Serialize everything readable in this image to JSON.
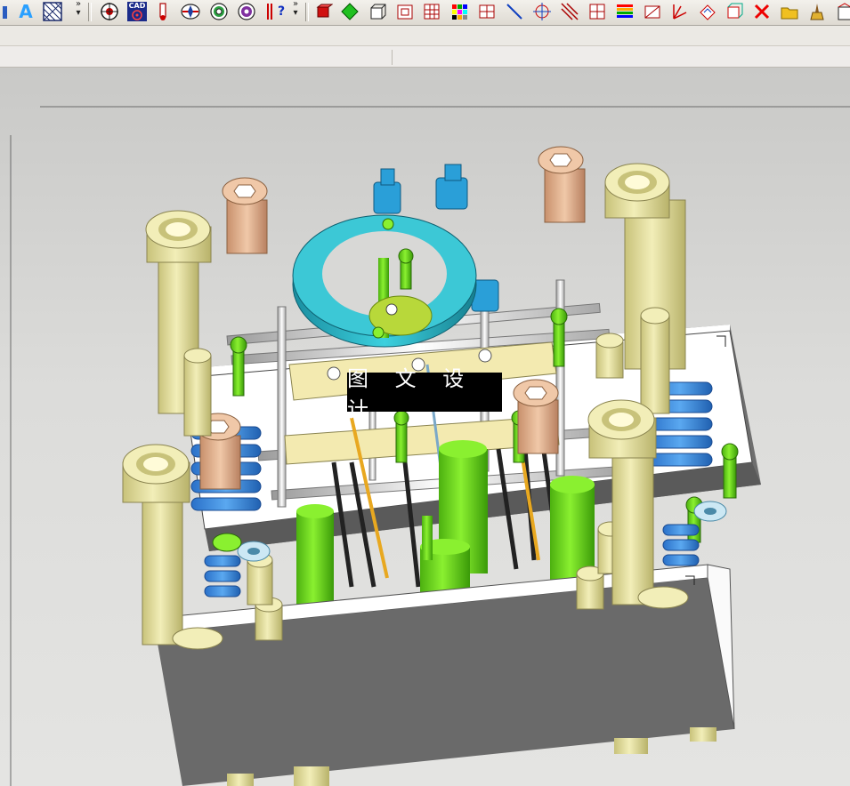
{
  "toolbar": {
    "cad_label": "CAD",
    "text_tool_glyph": "A",
    "query_tool_glyph": "?",
    "more_glyph": "»",
    "icons": [
      "red-block-icon",
      "green-diamond-icon",
      "box-outline-icon",
      "frame-icon",
      "grid-icon",
      "color-palette-icon",
      "component-icon",
      "line-icon",
      "target-icon",
      "hatch-icon",
      "cross-grid-icon",
      "layers-icon",
      "flat-part-icon",
      "axis-icon",
      "rotate-view-icon",
      "view-cube-icon",
      "delete-icon",
      "folder-icon",
      "brush-icon",
      "box-end-icon"
    ]
  },
  "viewport": {
    "background": "#d6d6d4",
    "watermark": "图 文 设 计"
  },
  "colors": {
    "plate_top": "#ffffff",
    "plate_front": "#6a6a6a",
    "post": "#e6e0a0",
    "pin_green": "#6ee01c",
    "spring_blue": "#3f8ee0",
    "ring_cyan": "#29b6c6",
    "fitting_blue": "#2a9fd8",
    "screw_head": "#e8b898",
    "plate_yellow": "#f3eab0",
    "rod_orange": "#e8a820"
  }
}
